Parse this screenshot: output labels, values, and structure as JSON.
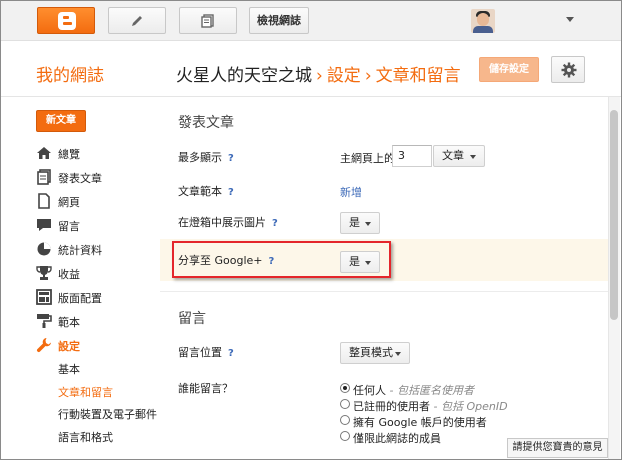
{
  "topbar": {
    "logo_icon": "blogger-logo-icon",
    "edit_icon": "pencil-icon",
    "posts_icon": "posts-list-icon",
    "view_blog": "檢視網誌",
    "account_icon": "avatar-photo"
  },
  "header": {
    "blog_title": "我的網誌",
    "crumb_blog_name": "火星人的天空之城",
    "crumb_settings": "設定",
    "crumb_page": "文章和留言",
    "separator": "›",
    "save_button": "儲存設定",
    "gear_icon": "gear-icon"
  },
  "sidebar": {
    "new_post": "新文章",
    "items": [
      {
        "label": "總覽",
        "icon": "home-icon"
      },
      {
        "label": "發表文章",
        "icon": "posts-icon"
      },
      {
        "label": "網頁",
        "icon": "page-icon"
      },
      {
        "label": "留言",
        "icon": "comment-icon"
      },
      {
        "label": "統計資料",
        "icon": "pie-chart-icon"
      },
      {
        "label": "收益",
        "icon": "trophy-icon"
      },
      {
        "label": "版面配置",
        "icon": "layout-icon"
      },
      {
        "label": "範本",
        "icon": "paint-roller-icon"
      },
      {
        "label": "設定",
        "icon": "wrench-icon"
      }
    ],
    "sub_items": [
      "基本",
      "文章和留言",
      "行動裝置及電子郵件",
      "語言和格式"
    ]
  },
  "posts_section": {
    "title": "發表文章",
    "max_show_label": "最多顯示",
    "max_show_prefix": "主網頁上的",
    "max_show_value": "3",
    "max_show_unit": "文章",
    "template_label": "文章範本",
    "template_link": "新增",
    "lightbox_label": "在燈箱中展示圖片",
    "lightbox_value": "是",
    "share_label": "分享至 Google+",
    "share_value": "是",
    "help": "?"
  },
  "comments_section": {
    "title": "留言",
    "location_label": "留言位置",
    "location_value": "整頁模式",
    "who_label": "誰能留言？",
    "options": [
      {
        "text": "任何人",
        "hint": " - 包括匿名使用者",
        "selected": true
      },
      {
        "text": "已註冊的使用者",
        "hint": " - 包括 OpenID",
        "selected": false
      },
      {
        "text": "擁有 Google 帳戶的使用者",
        "hint": "",
        "selected": false
      },
      {
        "text": "僅限此網誌的成員",
        "hint": "",
        "selected": false
      }
    ]
  },
  "feedback": "請提供您寶貴的意見",
  "colors": {
    "accent": "#f36c10",
    "link": "#3d6ab8",
    "highlight_border": "#e4262b",
    "highlight_band": "#fdf7e9"
  }
}
